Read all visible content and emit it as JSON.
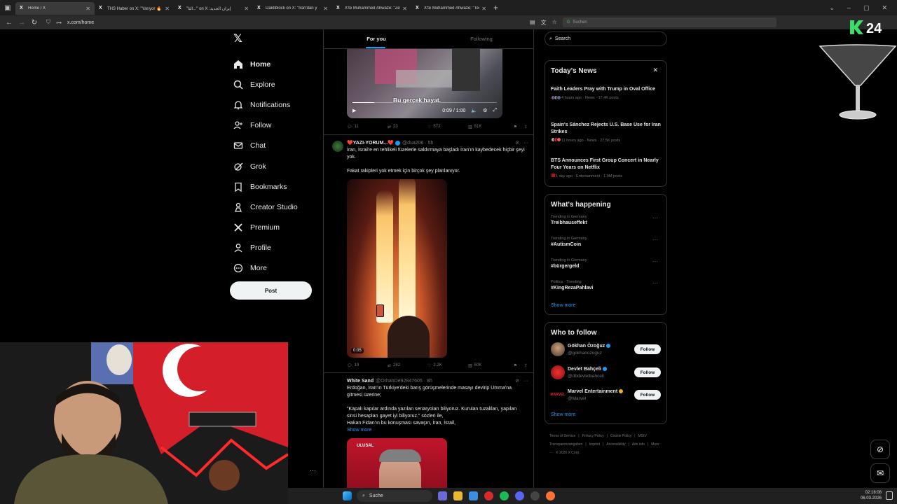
{
  "browser": {
    "tabs": [
      {
        "title": "Home / X",
        "active": true
      },
      {
        "title": "THS Haber on X: \"Yarıyor 🔥 Fr",
        "active": false
      },
      {
        "title": "\"الثأ...\" on X :إيران الجديد",
        "active": false
      },
      {
        "title": "Daktiblock on X: \"İran'dan y",
        "active": false
      },
      {
        "title": "X'te Muhammed Ahwaze: \"Zev",
        "active": false
      },
      {
        "title": "X'te Muhammed Ahwaze: \"Tesl",
        "active": false
      }
    ],
    "url": "x.com/home",
    "search_placeholder": "Suchen"
  },
  "nav": {
    "items": [
      {
        "label": "Home",
        "icon": "home-icon"
      },
      {
        "label": "Explore",
        "icon": "search-icon"
      },
      {
        "label": "Notifications",
        "icon": "bell-icon"
      },
      {
        "label": "Follow",
        "icon": "add-person-icon"
      },
      {
        "label": "Chat",
        "icon": "mail-icon"
      },
      {
        "label": "Grok",
        "icon": "grok-icon"
      },
      {
        "label": "Bookmarks",
        "icon": "bookmark-icon"
      },
      {
        "label": "Creator Studio",
        "icon": "creator-icon"
      },
      {
        "label": "Premium",
        "icon": "x-logo-icon"
      },
      {
        "label": "Profile",
        "icon": "person-icon"
      },
      {
        "label": "More",
        "icon": "more-circle-icon"
      }
    ],
    "post_label": "Post"
  },
  "feed": {
    "tabs": [
      "For you",
      "Following"
    ],
    "video1": {
      "caption": "Bu gerçek hayat.",
      "time": "0:09 / 1:00",
      "progress": 0.15,
      "stats": {
        "replies": "11",
        "reposts": "23",
        "likes": "572",
        "views": "81K"
      }
    },
    "tweet2": {
      "name": "❤️YAZI-YORUM...❤️",
      "handle": "@dua206 · 5h",
      "text1": "İran, İsrail'e en tehlikeli füzelerle saldırmaya başladı İran'ın kaybedecek hiçbir şeyi yok.",
      "text2": "Fakat rakipleri yok etmek için birçok şey planlanıyor.",
      "duration": "0:05",
      "stats": {
        "replies": "19",
        "reposts": "282",
        "likes": "2.2K",
        "views": "50K"
      }
    },
    "tweet3": {
      "name": "White Sand",
      "handle": "@OrhanDe92847605 · 8h",
      "text1": "Erdoğan, İran'ın Türkiye'deki barış görüşmelerinde masayı devirip Umma'na gitmesi üzerine;",
      "text2": "\"Kapalı kapılar ardında yazılan senaryoları biliyoruz. Kurulan tuzakları, yapılan sinsi hesapları gayet iyi biliyoruz.\"  sözleri ile,",
      "text3": "Hakan Fidan'ın bu konuşması savaşın, İran, İsrail,",
      "show_more": "Show more",
      "image_logo": "ULUSAL"
    }
  },
  "sidebar": {
    "search_placeholder": "Search",
    "news": {
      "title": "Today's News",
      "items": [
        {
          "headline": "Faith Leaders Pray with Trump in Oval Office",
          "meta": "4 hours ago · News · 17.4K posts"
        },
        {
          "headline": "Spain's Sánchez Rejects U.S. Base Use for Iran Strikes",
          "meta": "11 hours ago · News · 27.5K posts"
        },
        {
          "headline": "BTS Announces First Group Concert in Nearly Four Years on Netflix",
          "meta": "1 day ago · Entertainment · 1.9M posts"
        }
      ]
    },
    "happening": {
      "title": "What's happening",
      "items": [
        {
          "context": "Trending in Germany",
          "topic": "Treibhauseffekt"
        },
        {
          "context": "Trending in Germany",
          "topic": "#AutismCoin"
        },
        {
          "context": "Trending in Germany",
          "topic": "#bürgergeld"
        },
        {
          "context": "Politics · Trending",
          "topic": "#KingRezaPahlavi"
        }
      ],
      "show_more": "Show more"
    },
    "who": {
      "title": "Who to follow",
      "items": [
        {
          "name": "Gökhan Özoğuz",
          "handle": "@gokhanozoguz",
          "button": "Follow"
        },
        {
          "name": "Devlet Bahçeli",
          "handle": "@dbdevletbahceli",
          "button": "Follow"
        },
        {
          "name": "Marvel Entertainment",
          "handle": "@Marvel",
          "button": "Follow"
        }
      ],
      "show_more": "Show more"
    },
    "footer": [
      "Terms of Service",
      "|",
      "Privacy Policy",
      "|",
      "Cookie Policy",
      "|",
      "MStV Transparenzangaben",
      "|",
      "Imprint",
      "|",
      "Accessibility",
      "|",
      "Ads info",
      "|",
      "More ···",
      "© 2026 X Corp."
    ]
  },
  "overlay": {
    "brand": "24"
  },
  "taskbar": {
    "search": "Suche",
    "time": "02:18:08",
    "date": "06.03.2026"
  },
  "colors": {
    "accent": "#1d9bf0",
    "background": "#000000",
    "border": "#2f3336",
    "muted": "#71767b"
  }
}
